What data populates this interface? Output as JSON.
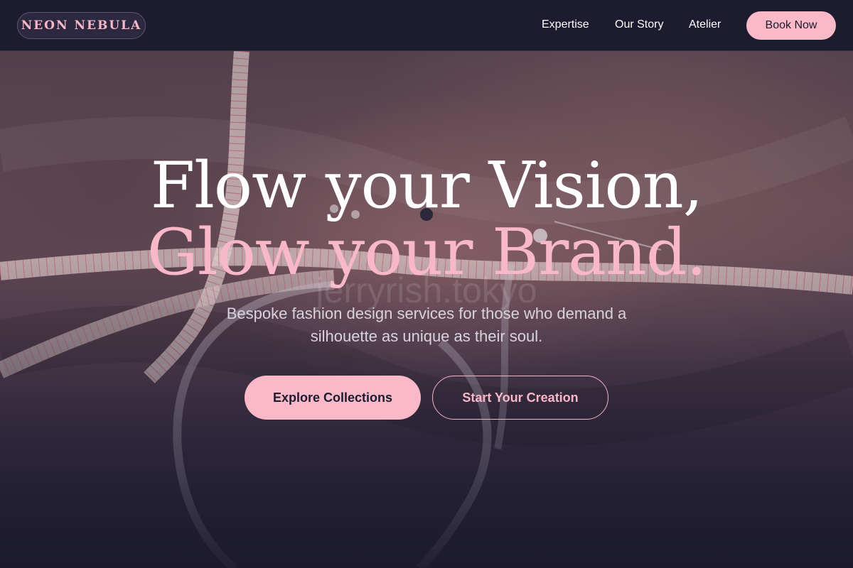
{
  "header": {
    "logo": "NEON NEBULA",
    "nav": [
      {
        "label": "Expertise"
      },
      {
        "label": "Our Story"
      },
      {
        "label": "Atelier"
      }
    ],
    "cta_label": "Book Now"
  },
  "hero": {
    "headline_line_1": "Flow your Vision,",
    "headline_line_2": "Glow your Brand.",
    "watermark": "jerryrish.tokyo",
    "subtitle": "Bespoke fashion design services for those who demand a silhouette as unique as their soul.",
    "primary_cta": "Explore Collections",
    "secondary_cta": "Start Your Creation",
    "background_image": "fabric-and-measuring-tape-photo"
  },
  "colors": {
    "accent_pink": "#fab9c9",
    "navy": "#1d1b30",
    "text_light": "#ffffff",
    "text_muted": "#d8d3dc"
  }
}
